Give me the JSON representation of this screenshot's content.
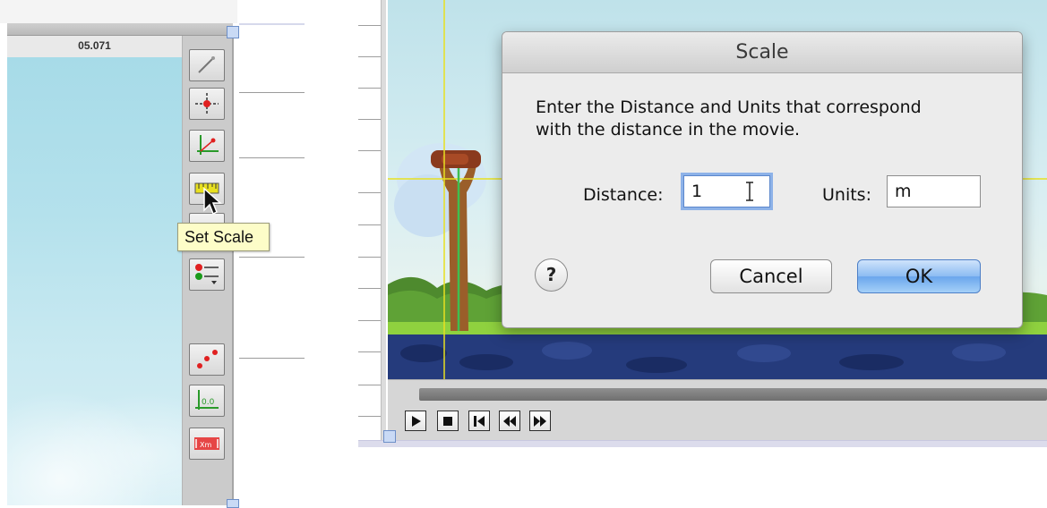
{
  "left_panel": {
    "column_header": "05.071",
    "tools": [
      {
        "name": "track-tool-icon"
      },
      {
        "name": "origin-target-icon"
      },
      {
        "name": "axes-icon"
      },
      {
        "name": "set-scale-icon"
      },
      {
        "name": "hidden-tool-icon"
      },
      {
        "name": "point-track-options-icon"
      },
      {
        "name": "show-points-icon"
      },
      {
        "name": "coordinate-origin-icon"
      },
      {
        "name": "measure-distance-icon"
      }
    ],
    "tooltip": "Set Scale"
  },
  "dialog": {
    "title": "Scale",
    "message_line1": "Enter the Distance and Units that correspond",
    "message_line2": "with the distance in the movie.",
    "distance_label": "Distance:",
    "distance_value": "1",
    "units_label": "Units:",
    "units_value": "m",
    "help_label": "?",
    "cancel_label": "Cancel",
    "ok_label": "OK"
  },
  "player_controls": {
    "buttons": [
      "play-icon",
      "stop-icon",
      "step-back-icon",
      "rewind-icon",
      "fast-forward-icon"
    ]
  },
  "colors": {
    "crosshair": "#e8e020",
    "scale_line": "#3fbf4f",
    "tooltip_bg": "#fdfdc8",
    "ok_button": "#8cbcf2"
  }
}
